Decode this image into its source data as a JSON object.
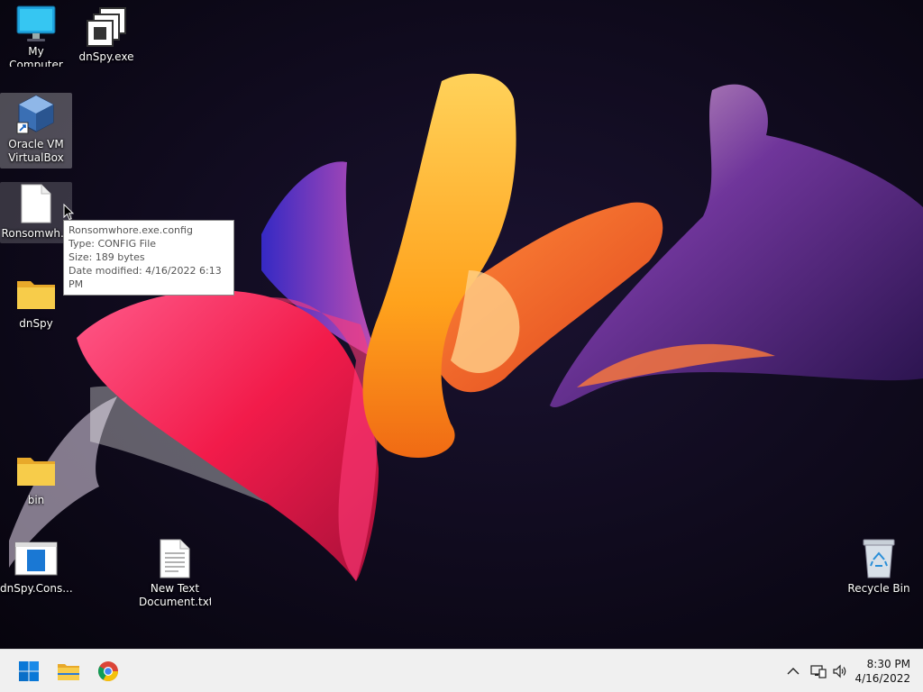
{
  "desktop": {
    "icons": [
      {
        "label": "My Computer",
        "icon": "monitor-icon"
      },
      {
        "label": "dnSpy.exe",
        "icon": "app-window-icon"
      },
      {
        "label": "Oracle VM VirtualBox",
        "icon": "virtualbox-icon"
      },
      {
        "label": "Ronsomwh...",
        "icon": "file-icon"
      },
      {
        "label": "dnSpy",
        "icon": "folder-icon"
      },
      {
        "label": "bin",
        "icon": "folder-icon"
      },
      {
        "label": "dnSpy.Cons...",
        "icon": "console-app-icon"
      },
      {
        "label": "New Text Document.txt",
        "icon": "text-file-icon"
      },
      {
        "label": "Recycle Bin",
        "icon": "recycle-bin-icon"
      }
    ]
  },
  "tooltip": {
    "name": "Ronsomwhore.exe.config",
    "type": "Type: CONFIG File",
    "size": "Size: 189 bytes",
    "modified": "Date modified: 4/16/2022 6:13 PM"
  },
  "taskbar": {
    "pinned": [
      {
        "name": "start-button",
        "icon": "windows-logo-icon"
      },
      {
        "name": "file-explorer-button",
        "icon": "folder-icon"
      },
      {
        "name": "chrome-button",
        "icon": "chrome-icon"
      }
    ],
    "tray": {
      "chevron": "chevron-up-icon",
      "network": "network-icon",
      "volume": "volume-icon"
    },
    "clock": {
      "time": "8:30 PM",
      "date": "4/16/2022"
    }
  },
  "colors": {
    "taskbar": "#f0f0f0",
    "folder": "#f5c342",
    "accent": "#0078d4"
  }
}
